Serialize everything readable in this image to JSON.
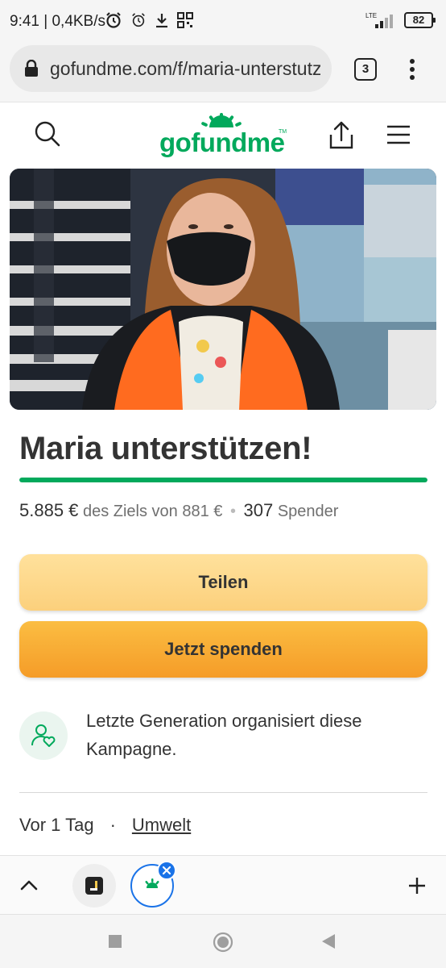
{
  "status_bar": {
    "time": "9:41 | 0,4KB/s",
    "network": "LTE",
    "battery": "82"
  },
  "browser": {
    "url": "gofundme.com/f/maria-unterstutzen",
    "tab_count": "3"
  },
  "site": {
    "logo_text": "gofundme",
    "logo_tm": "TM"
  },
  "campaign": {
    "title": "Maria unterstützen!",
    "raised": "5.885 €",
    "goal_text": "des Ziels von 881 €",
    "donor_count": "307",
    "donor_label": "Spender",
    "progress_fraction": 1.0,
    "share_label": "Teilen",
    "donate_label": "Jetzt spenden",
    "organizer_text": "Letzte Generation organisiert diese Kampagne.",
    "created": "Vor 1 Tag",
    "category": "Umwelt"
  },
  "colors": {
    "brand_green": "#02a95c",
    "share_button": "#fcd07c",
    "donate_button": "#f59c28",
    "tab_accent": "#1a73e8"
  }
}
